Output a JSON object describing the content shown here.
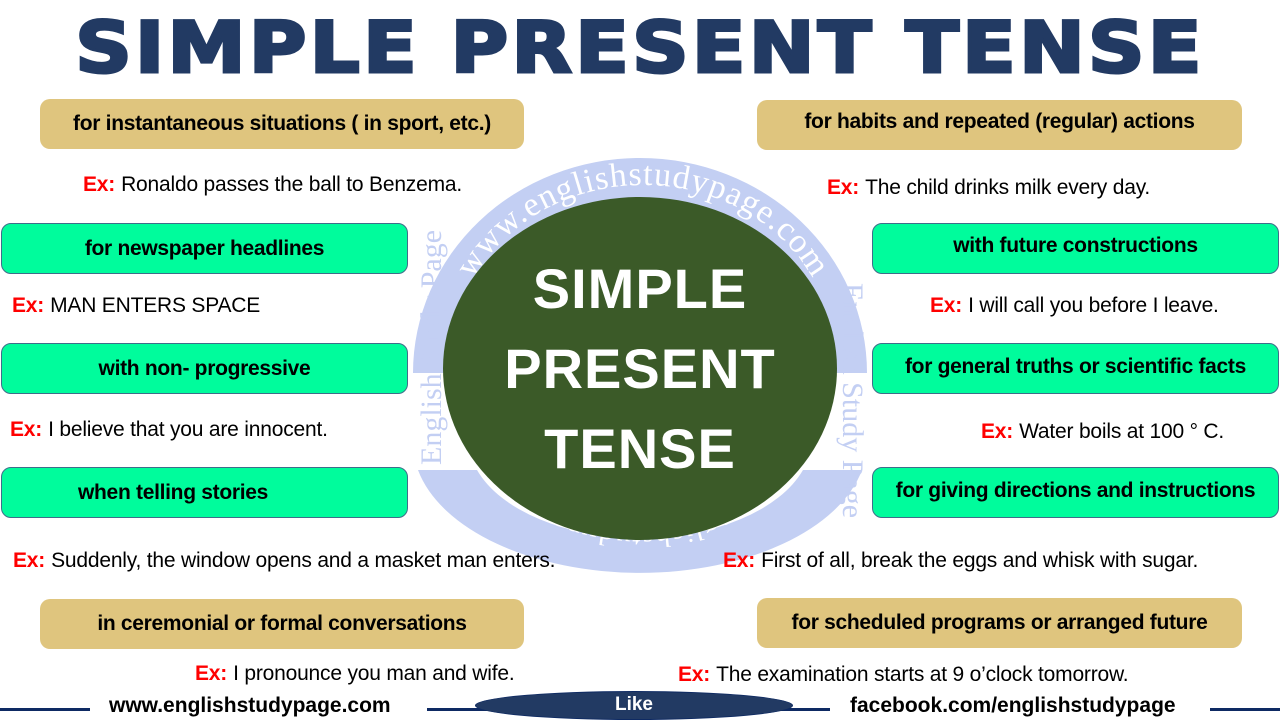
{
  "title": "SIMPLE PRESENT TENSE",
  "center": {
    "lines": [
      "SIMPLE",
      "PRESENT",
      "TENSE"
    ]
  },
  "watermark": {
    "ring_text_top": "www.englishstudypage.com",
    "ring_text_bottom": "www.englishstudypage.com",
    "side_text": "English Study Page",
    "color": "#c3cff3"
  },
  "example_label": "Ex:",
  "left_uses": [
    {
      "label": "for instantaneous situations ( in sport, etc.)",
      "style": "tan",
      "example": "Ronaldo passes the ball to Benzema."
    },
    {
      "label": "for newspaper headlines",
      "style": "green",
      "example": "MAN ENTERS SPACE"
    },
    {
      "label": "with non- progressive",
      "style": "green",
      "example": "I believe that you are innocent."
    },
    {
      "label": "when telling stories",
      "style": "green",
      "example": "Suddenly, the window opens and a masket man enters."
    },
    {
      "label": "in ceremonial or formal conversations",
      "style": "tan",
      "example": "I pronounce you man and wife."
    }
  ],
  "right_uses": [
    {
      "label": "for habits and   repeated (regular) actions",
      "style": "tan",
      "example": "The child drinks milk every day."
    },
    {
      "label": "with future constructions",
      "style": "green",
      "example": "I will call you before I leave."
    },
    {
      "label": "for general truths or scientific facts",
      "style": "green",
      "example": "Water boils at 100 ° C."
    },
    {
      "label": "for giving directions and instructions",
      "style": "green",
      "example": "First of all, break the eggs and whisk with sugar."
    },
    {
      "label": "for scheduled programs or arranged future",
      "style": "tan",
      "example": "The examination starts at 9 o’clock tomorrow."
    }
  ],
  "footer": {
    "website": "www.englishstudypage.com",
    "like_label": "Like",
    "facebook": "facebook.com/englishstudypage"
  },
  "colors": {
    "title": "#223a63",
    "tan_box": "#dfc57e",
    "green_box": "#00fc9c",
    "center_circle": "#3b5a28",
    "example_label": "#ff0000",
    "footer_line": "#0e2a63"
  }
}
